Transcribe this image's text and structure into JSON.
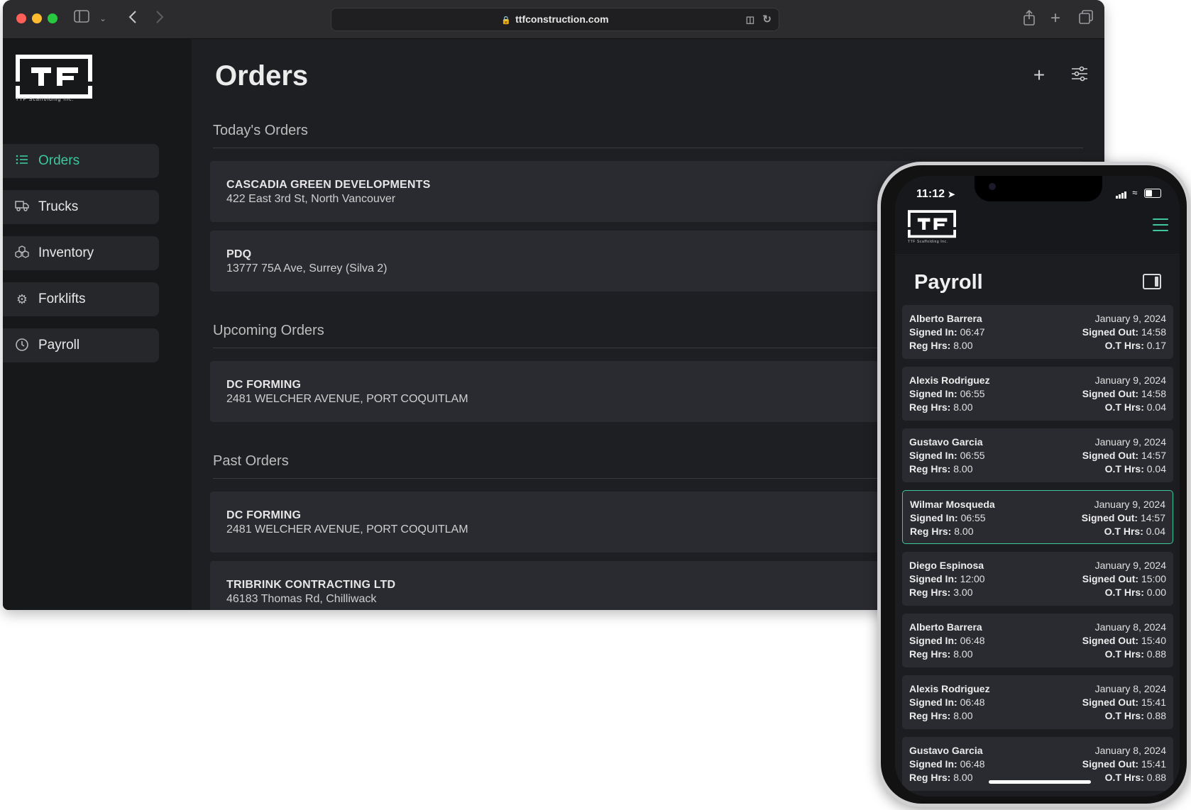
{
  "browser": {
    "url": "ttfconstruction.com"
  },
  "brand": {
    "caption": "TTF Scaffolding Inc."
  },
  "sidebar": {
    "items": [
      {
        "label": "Orders",
        "icon": "list-icon"
      },
      {
        "label": "Trucks",
        "icon": "truck-icon"
      },
      {
        "label": "Inventory",
        "icon": "boxes-icon"
      },
      {
        "label": "Forklifts",
        "icon": "gear-icon"
      },
      {
        "label": "Payroll",
        "icon": "clock-icon"
      }
    ]
  },
  "main": {
    "title": "Orders",
    "sections": [
      {
        "title": "Today's Orders",
        "orders": [
          {
            "name": "CASCADIA GREEN DEVELOPMENTS",
            "address": "422 East 3rd St, North Vancouver"
          },
          {
            "name": "PDQ",
            "address": "13777 75A Ave, Surrey (Silva 2)"
          }
        ]
      },
      {
        "title": "Upcoming Orders",
        "orders": [
          {
            "name": "DC FORMING",
            "address": "2481 WELCHER AVENUE, PORT COQUITLAM"
          }
        ]
      },
      {
        "title": "Past Orders",
        "orders": [
          {
            "name": "DC FORMING",
            "address": "2481 WELCHER AVENUE, PORT COQUITLAM"
          },
          {
            "name": "TRIBRINK CONTRACTING LTD",
            "address": "46183 Thomas Rd, Chilliwack"
          }
        ]
      }
    ]
  },
  "phone": {
    "time": "11:12",
    "title": "Payroll",
    "labels": {
      "signed_in": "Signed In:",
      "signed_out": "Signed Out:",
      "reg_hrs": "Reg Hrs:",
      "ot_hrs": "O.T Hrs:"
    },
    "entries": [
      {
        "name": "Alberto Barrera",
        "date": "January 9, 2024",
        "signed_in": "06:47",
        "signed_out": "14:58",
        "reg_hrs": "8.00",
        "ot_hrs": "0.17"
      },
      {
        "name": "Alexis Rodriguez",
        "date": "January 9, 2024",
        "signed_in": "06:55",
        "signed_out": "14:58",
        "reg_hrs": "8.00",
        "ot_hrs": "0.04"
      },
      {
        "name": "Gustavo Garcia",
        "date": "January 9, 2024",
        "signed_in": "06:55",
        "signed_out": "14:57",
        "reg_hrs": "8.00",
        "ot_hrs": "0.04"
      },
      {
        "name": "Wilmar Mosqueda",
        "date": "January 9, 2024",
        "signed_in": "06:55",
        "signed_out": "14:57",
        "reg_hrs": "8.00",
        "ot_hrs": "0.04"
      },
      {
        "name": "Diego Espinosa",
        "date": "January 9, 2024",
        "signed_in": "12:00",
        "signed_out": "15:00",
        "reg_hrs": "3.00",
        "ot_hrs": "0.00"
      },
      {
        "name": "Alberto Barrera",
        "date": "January 8, 2024",
        "signed_in": "06:48",
        "signed_out": "15:40",
        "reg_hrs": "8.00",
        "ot_hrs": "0.88"
      },
      {
        "name": "Alexis Rodriguez",
        "date": "January 8, 2024",
        "signed_in": "06:48",
        "signed_out": "15:41",
        "reg_hrs": "8.00",
        "ot_hrs": "0.88"
      },
      {
        "name": "Gustavo Garcia",
        "date": "January 8, 2024",
        "signed_in": "06:48",
        "signed_out": "15:41",
        "reg_hrs": "8.00",
        "ot_hrs": "0.88"
      }
    ]
  },
  "colors": {
    "accent": "#3ec79a",
    "sidebar_bg": "#17181a",
    "main_bg": "#1e1f22",
    "card_bg": "#2a2b30"
  }
}
